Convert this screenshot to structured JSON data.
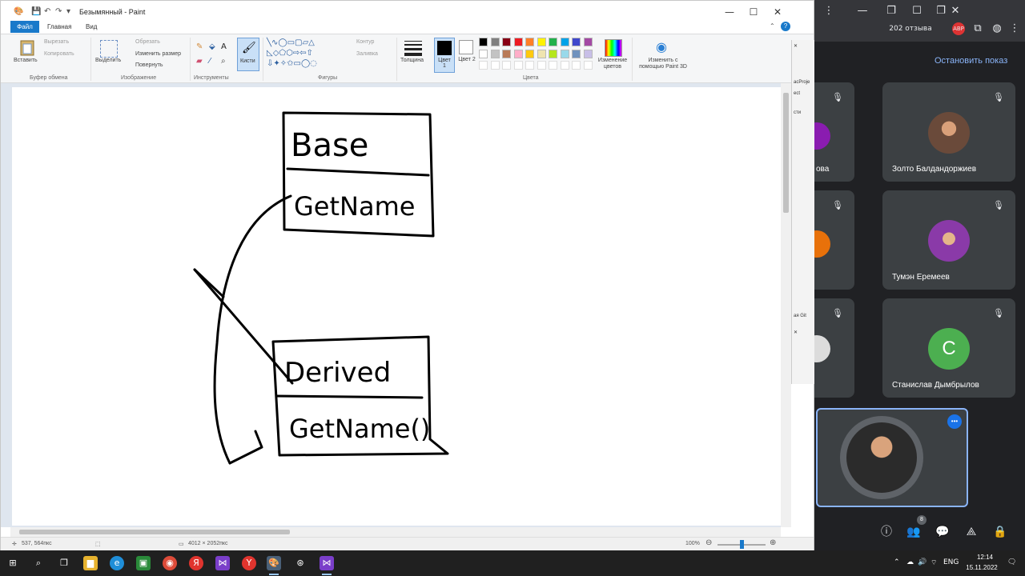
{
  "paint": {
    "title": "Безымянный - Paint",
    "tabs": {
      "file": "Файл",
      "home": "Главная",
      "view": "Вид"
    },
    "ribbon": {
      "clipboard": {
        "paste": "Вставить",
        "cut": "Вырезать",
        "copy": "Копировать",
        "label": "Буфер обмена"
      },
      "image": {
        "select": "Выделить",
        "crop": "Обрезать",
        "resize": "Изменить размер",
        "rotate": "Повернуть",
        "label": "Изображение"
      },
      "tools": {
        "label": "Инструменты"
      },
      "brushes": {
        "label": "Кисти"
      },
      "shapes": {
        "outline": "Контур",
        "fill": "Заливка",
        "label": "Фигуры"
      },
      "size": {
        "label": "Толщина"
      },
      "color1": {
        "label": "Цвет 1"
      },
      "color2": {
        "label": "Цвет 2"
      },
      "colors": {
        "label": "Цвета",
        "edit": "Изменение цветов"
      },
      "paint3d": {
        "label": "Изменить с помощью Paint 3D"
      }
    },
    "palette": [
      "#000000",
      "#7f7f7f",
      "#880015",
      "#ed1c24",
      "#ff7f27",
      "#fff200",
      "#22b14c",
      "#00a2e8",
      "#3f48cc",
      "#a349a4",
      "#ffffff",
      "#c3c3c3",
      "#b97a57",
      "#ffaec9",
      "#ffc90e",
      "#efe4b0",
      "#b5e61d",
      "#99d9ea",
      "#7092be",
      "#c8bfe7"
    ],
    "drawing": {
      "top_box_text": "Base",
      "top_method": "GetName",
      "bottom_box_text": "Derived",
      "bottom_method": "GetName()"
    },
    "status": {
      "cursor": "537, 564пкс",
      "canvas_size": "4012 × 2052пкс",
      "zoom": "100%"
    }
  },
  "sliver": {
    "item1": "acProje",
    "item2": "ect",
    "item3": "сти",
    "item4": "ая Git"
  },
  "meet": {
    "stop_show": "Остановить показ",
    "participants": [
      {
        "name": "Золто Балдандоржиев",
        "avatar_color": "#6a4a3a"
      },
      {
        "name": "Тумэн Еремеев",
        "avatar_color": "#8a3aa8"
      },
      {
        "name": "Станислав Дымбрылов",
        "avatar_color": "#4caf50",
        "initial": "C"
      }
    ],
    "partial_names": [
      "ова"
    ],
    "people_count": "8"
  },
  "taskbar": {
    "lang": "ENG",
    "time": "12:14",
    "date": "15.11.2022",
    "browser_badge": "202 отзыва"
  }
}
